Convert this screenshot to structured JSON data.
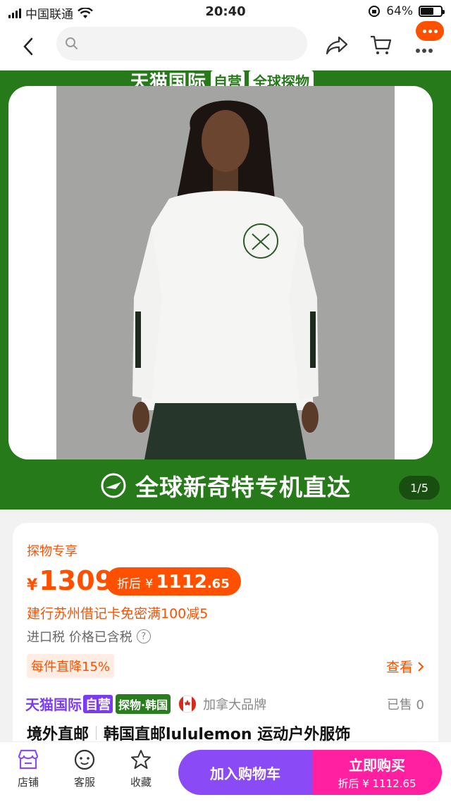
{
  "status_bar": {
    "carrier": "中国联通",
    "time": "20:40",
    "battery": "64%",
    "battery_level": 0.64
  },
  "search": {
    "placeholder": ""
  },
  "hero": {
    "banner_brand": "天猫国际",
    "banner_self": "自营",
    "banner_tag": "全球探物",
    "slogan": "全球新奇特专机直达",
    "page_indicator": "1/5"
  },
  "product": {
    "exclusive_label": "探物专享",
    "price_symbol": "¥",
    "price": "1309",
    "discount_label": "折后",
    "discount_symbol": "¥",
    "discount_int": "1112",
    "discount_dec": ".65",
    "promo": "建行苏州借记卡免密满100减5",
    "tax": "进口税 价格已含税",
    "per_item": "每件直降15%",
    "view_more": "查看",
    "shop_brand": "天猫国际",
    "shop_self": "自营",
    "shop_tag": "探物·韩国",
    "origin": "加拿大品牌",
    "sold": "已售 0",
    "title_tag": "境外直邮",
    "title": "韩国直邮lululemon 运动户外服饰"
  },
  "bottom_bar": {
    "store": "店铺",
    "service": "客服",
    "favorite": "收藏",
    "add_to_cart": "加入购物车",
    "buy_now": "立即购买",
    "buy_now_sub": "折后 ¥ 1112.65"
  },
  "colors": {
    "accent": "#ff5000",
    "green": "#267a1a",
    "purple": "#8a4af6",
    "pink": "#ff1fa0"
  }
}
